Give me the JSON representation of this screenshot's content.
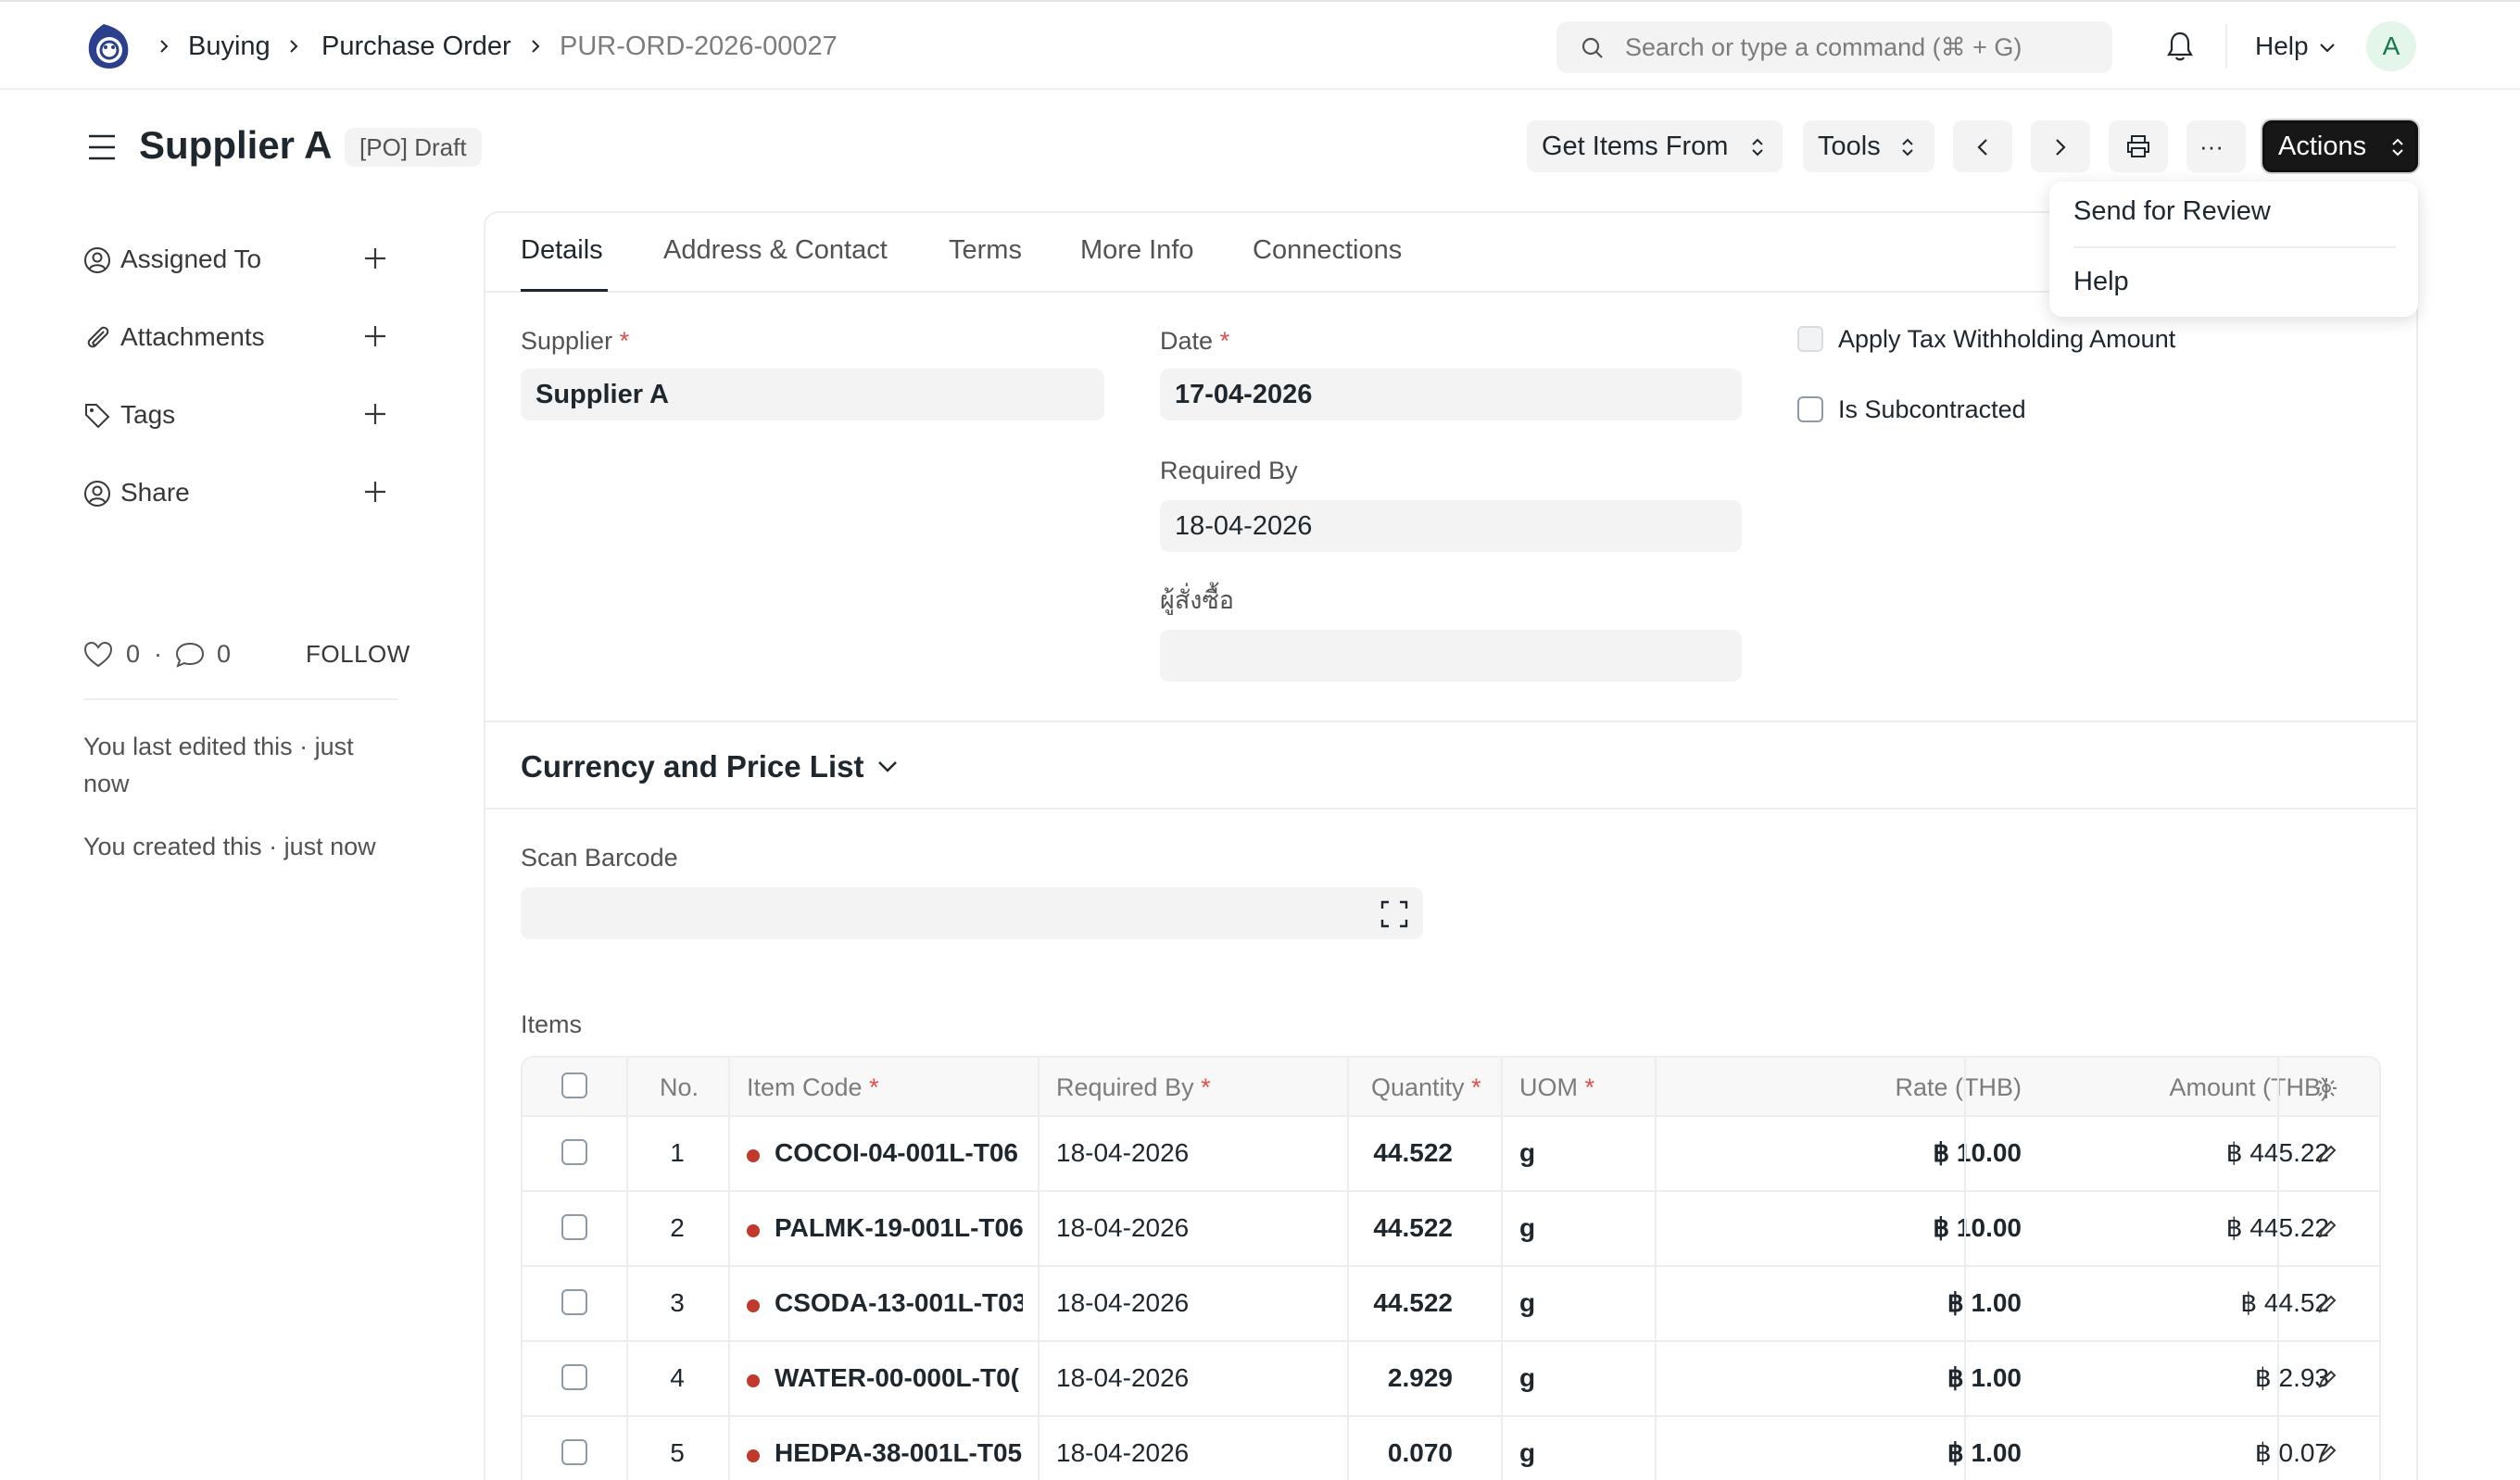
{
  "navbar": {
    "breadcrumbs": [
      "Buying",
      "Purchase Order",
      "PUR-ORD-2026-00027"
    ],
    "search_placeholder": "Search or type a command (⌘ + G)",
    "help_label": "Help",
    "avatar_initial": "A"
  },
  "page": {
    "title": "Supplier A",
    "status": "[PO] Draft",
    "buttons": {
      "get_items_from": "Get Items From",
      "tools": "Tools",
      "more": "···",
      "actions": "Actions"
    },
    "actions_menu": [
      "Send for Review",
      "Help"
    ]
  },
  "sidebar": {
    "items": [
      {
        "label": "Assigned To",
        "icon": "user-icon"
      },
      {
        "label": "Attachments",
        "icon": "paperclip-icon"
      },
      {
        "label": "Tags",
        "icon": "tag-icon"
      },
      {
        "label": "Share",
        "icon": "share-user-icon"
      }
    ],
    "likes": "0",
    "comments": "0",
    "follow_label": "FOLLOW",
    "activity": [
      "You last edited this · just now",
      "You created this · just now"
    ]
  },
  "tabs": [
    "Details",
    "Address & Contact",
    "Terms",
    "More Info",
    "Connections"
  ],
  "form": {
    "supplier_label": "Supplier",
    "supplier_value": "Supplier A",
    "date_label": "Date",
    "date_value": "17-04-2026",
    "required_by_label": "Required By",
    "required_by_value": "18-04-2026",
    "orderer_label": "ผู้สั่งซื้อ",
    "orderer_value": "",
    "apply_tax_label": "Apply Tax Withholding Amount",
    "is_subcontracted_label": "Is Subcontracted",
    "required_mark": "*"
  },
  "currency_section": {
    "title": "Currency and Price List"
  },
  "scan_barcode_label": "Scan Barcode",
  "items_table": {
    "label": "Items",
    "columns": {
      "no": "No.",
      "item_code": "Item Code",
      "required_by": "Required By",
      "quantity": "Quantity",
      "uom": "UOM",
      "rate": "Rate (THB)",
      "amount": "Amount (THB)"
    },
    "rows": [
      {
        "no": "1",
        "item_code": "COCOI-04-001L-T06",
        "required_by": "18-04-2026",
        "quantity": "44.522",
        "uom": "g",
        "rate": "฿ 10.00",
        "amount": "฿ 445.22"
      },
      {
        "no": "2",
        "item_code": "PALMK-19-001L-T06:",
        "required_by": "18-04-2026",
        "quantity": "44.522",
        "uom": "g",
        "rate": "฿ 10.00",
        "amount": "฿ 445.22"
      },
      {
        "no": "3",
        "item_code": "CSODA-13-001L-T03",
        "required_by": "18-04-2026",
        "quantity": "44.522",
        "uom": "g",
        "rate": "฿ 1.00",
        "amount": "฿ 44.52"
      },
      {
        "no": "4",
        "item_code": "WATER-00-000L-T0(",
        "required_by": "18-04-2026",
        "quantity": "2.929",
        "uom": "g",
        "rate": "฿ 1.00",
        "amount": "฿ 2.93"
      },
      {
        "no": "5",
        "item_code": "HEDPA-38-001L-T05:",
        "required_by": "18-04-2026",
        "quantity": "0.070",
        "uom": "g",
        "rate": "฿ 1.00",
        "amount": "฿ 0.07"
      }
    ]
  },
  "colors": {
    "accent_dark": "#171717",
    "required": "#e24c4c",
    "item_dot": "#c0392b",
    "avatar_bg": "#e4f5e9"
  }
}
